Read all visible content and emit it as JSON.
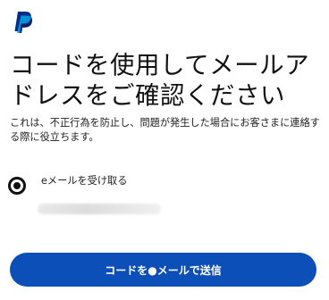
{
  "brand": {
    "logo_icon": "paypal-logo-icon",
    "colors": {
      "logo_dark": "#002c8a",
      "logo_light": "#009cde",
      "primary_button": "#0d4fb8"
    }
  },
  "main": {
    "heading": "コードを使用してメールアドレスをご確認ください",
    "description": "これは、不正行為を防止し、問題が発生した場合にお客さまに連絡する際に役立ちます。",
    "option": {
      "label": "eメールを受け取る",
      "selected": true
    },
    "send_button_label": "コードを●メールで送信"
  }
}
